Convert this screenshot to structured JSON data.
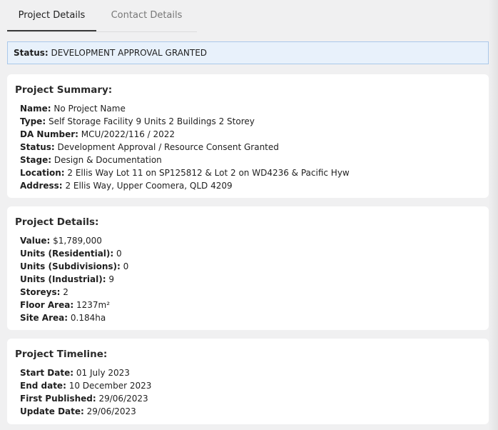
{
  "tabs": [
    {
      "label": "Project Details",
      "active": true
    },
    {
      "label": "Contact Details",
      "active": false
    }
  ],
  "status_bar": {
    "label": "Status:",
    "value": "DEVELOPMENT APPROVAL GRANTED"
  },
  "summary": {
    "title": "Project Summary:",
    "rows": [
      {
        "label": "Name:",
        "value": "No Project Name"
      },
      {
        "label": "Type:",
        "value": "Self Storage Facility 9 Units 2 Buildings 2 Storey"
      },
      {
        "label": "DA Number:",
        "value": "MCU/2022/116 / 2022"
      },
      {
        "label": "Status:",
        "value": "Development Approval / Resource Consent Granted"
      },
      {
        "label": "Stage:",
        "value": "Design & Documentation"
      },
      {
        "label": "Location:",
        "value": "2 Ellis Way Lot 11 on SP125812 & Lot 2 on WD4236 & Pacific Hyw"
      },
      {
        "label": "Address:",
        "value": "2 Ellis Way, Upper Coomera, QLD 4209"
      }
    ]
  },
  "details": {
    "title": "Project Details:",
    "rows": [
      {
        "label": "Value:",
        "value": "$1,789,000"
      },
      {
        "label": "Units (Residential):",
        "value": "0"
      },
      {
        "label": "Units (Subdivisions):",
        "value": "0"
      },
      {
        "label": "Units (Industrial):",
        "value": "9"
      },
      {
        "label": "Storeys:",
        "value": "2"
      },
      {
        "label": "Floor Area:",
        "value": "1237m²"
      },
      {
        "label": "Site Area:",
        "value": "0.184ha"
      }
    ]
  },
  "timeline": {
    "title": "Project Timeline:",
    "rows": [
      {
        "label": "Start Date:",
        "value": "01 July 2023"
      },
      {
        "label": "End date:",
        "value": "10 December 2023"
      },
      {
        "label": "First Published:",
        "value": "29/06/2023"
      },
      {
        "label": "Update Date:",
        "value": "29/06/2023"
      }
    ]
  }
}
